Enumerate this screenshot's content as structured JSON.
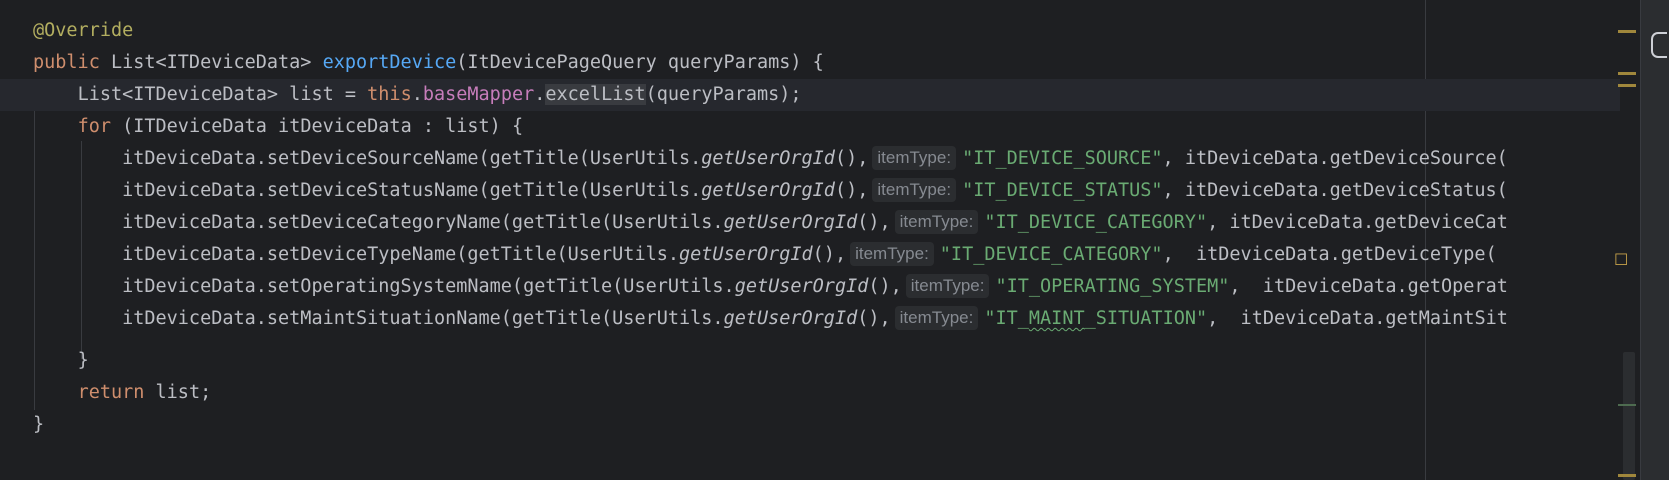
{
  "editor": {
    "lines": [
      {
        "annotation": "@Override"
      },
      {
        "kw_public": "public",
        "type_list": " List<ITDeviceData> ",
        "method": "exportDevice",
        "params": "(ItDevicePageQuery queryParams) {"
      },
      {
        "indent": "    ",
        "text1": "List<ITDeviceData> list = ",
        "kw_this": "this",
        "dot1": ".",
        "field": "baseMapper",
        "dot2": ".",
        "call": "excelList",
        "rest": "(queryParams);"
      },
      {
        "indent": "    ",
        "kw_for": "for",
        "rest": " (ITDeviceData itDeviceData : list) {"
      },
      {
        "call": "        itDeviceData.setDeviceSourceName(getTitle(UserUtils.",
        "static_call": "getUserOrgId",
        "after": "(),",
        "hint": "itemType:",
        "str": "\"IT_DEVICE_SOURCE\"",
        "tail": ", itDeviceData.getDeviceSource("
      },
      {
        "call": "        itDeviceData.setDeviceStatusName(getTitle(UserUtils.",
        "static_call": "getUserOrgId",
        "after": "(),",
        "hint": "itemType:",
        "str": "\"IT_DEVICE_STATUS\"",
        "tail": ", itDeviceData.getDeviceStatus("
      },
      {
        "call": "        itDeviceData.setDeviceCategoryName(getTitle(UserUtils.",
        "static_call": "getUserOrgId",
        "after": "(),",
        "hint": "itemType:",
        "str": "\"IT_DEVICE_CATEGORY\"",
        "tail": ", itDeviceData.getDeviceCat"
      },
      {
        "call": "        itDeviceData.setDeviceTypeName(getTitle(UserUtils.",
        "static_call": "getUserOrgId",
        "after": "(),",
        "hint": "itemType:",
        "str": "\"IT_DEVICE_CATEGORY\"",
        "tail": ",  itDeviceData.getDeviceType("
      },
      {
        "call": "        itDeviceData.setOperatingSystemName(getTitle(UserUtils.",
        "static_call": "getUserOrgId",
        "after": "(),",
        "hint": "itemType:",
        "str": "\"IT_OPERATING_SYSTEM\"",
        "tail": ",  itDeviceData.getOperat"
      },
      {
        "call": "        itDeviceData.setMaintSituationName(getTitle(UserUtils.",
        "static_call": "getUserOrgId",
        "after": "(),",
        "hint": "itemType:",
        "str_a": "\"IT_",
        "str_b": "MAINT",
        "str_c": "_SITUATION\"",
        "tail": ",  itDeviceData.getMaintSit"
      },
      {
        "indent": "    ",
        "brace": "}"
      },
      {
        "indent": "    ",
        "kw_return": "return",
        "rest": " list;"
      },
      {
        "brace": "}"
      }
    ]
  },
  "colors": {
    "background": "#1e1f22",
    "keyword": "#cf8e6d",
    "annotation": "#b3ae60",
    "method_decl": "#56a8f5",
    "field": "#c77dbb",
    "string": "#6aab73",
    "default_text": "#bcbec4"
  },
  "icons": [
    "database-icon",
    "todo-icon"
  ]
}
